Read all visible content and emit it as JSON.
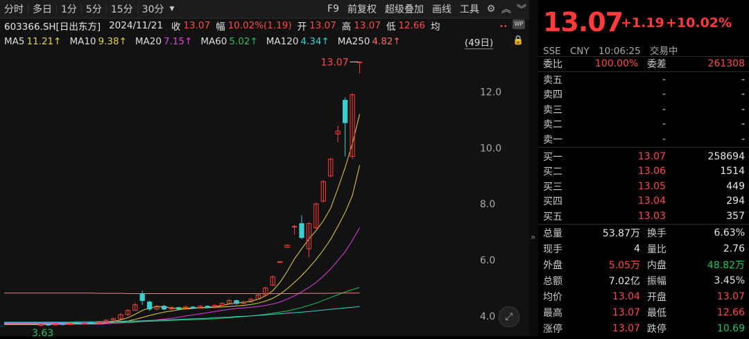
{
  "toolbar": {
    "periods": [
      "分时",
      "多日",
      "1分",
      "5分",
      "15分",
      "30分"
    ],
    "dropdown_icon": "triangle-down-icon",
    "right_items": [
      "F9",
      "前复权",
      "超级叠加",
      "画线",
      "工具"
    ],
    "right_icons": [
      "gear-icon",
      "chevron-up-double-icon",
      "chevron-down-double-icon"
    ]
  },
  "info": {
    "symbol": "603366.SH[日出东方]",
    "date": "2024/11/21",
    "close_label": "收",
    "close_value": "13.07",
    "change_label": "幅",
    "change_value": "10.02%(1.19)",
    "open_label": "开",
    "open_value": "13.07",
    "high_label": "高",
    "high_value": "13.07",
    "low_label": "低",
    "low_value": "12.66",
    "avg_label": "均"
  },
  "ma": [
    {
      "label": "MA5",
      "value": "11.21↑",
      "color": "#e6d44a"
    },
    {
      "label": "MA10",
      "value": "9.38↑",
      "color": "#e6d44a"
    },
    {
      "label": "MA20",
      "value": "7.15↑",
      "color": "#e040e0"
    },
    {
      "label": "MA60",
      "value": "5.02↑",
      "color": "#22c55e"
    },
    {
      "label": "MA120",
      "value": "4.34↑",
      "color": "#3ad0d0"
    },
    {
      "label": "MA250",
      "value": "4.82↑",
      "color": "#ff6a6a"
    }
  ],
  "period_badge": "(49日)",
  "wp_icon_text": "WP",
  "chart_annotations": {
    "max_label": "13.07",
    "min_label": "3.63",
    "y_ticks": [
      "12.0",
      "10.0",
      "8.0",
      "6.0",
      "4.0"
    ]
  },
  "chart_data": {
    "type": "candlestick",
    "y_ticks": [
      12.0,
      10.0,
      8.0,
      6.0,
      4.0
    ],
    "ylim": [
      3.6,
      13.3
    ],
    "grid": false,
    "candles": [
      {
        "o": 3.66,
        "c": 3.7,
        "h": 3.74,
        "l": 3.63
      },
      {
        "o": 3.7,
        "c": 3.68,
        "h": 3.73,
        "l": 3.65
      },
      {
        "o": 3.68,
        "c": 3.72,
        "h": 3.75,
        "l": 3.66
      },
      {
        "o": 3.72,
        "c": 3.7,
        "h": 3.76,
        "l": 3.68
      },
      {
        "o": 3.7,
        "c": 3.74,
        "h": 3.77,
        "l": 3.69
      },
      {
        "o": 3.74,
        "c": 3.72,
        "h": 3.78,
        "l": 3.7
      },
      {
        "o": 3.72,
        "c": 3.76,
        "h": 3.8,
        "l": 3.71
      },
      {
        "o": 3.76,
        "c": 3.74,
        "h": 3.79,
        "l": 3.72
      },
      {
        "o": 3.74,
        "c": 3.78,
        "h": 3.82,
        "l": 3.73
      },
      {
        "o": 3.78,
        "c": 3.85,
        "h": 3.88,
        "l": 3.76
      },
      {
        "o": 3.85,
        "c": 3.9,
        "h": 3.95,
        "l": 3.83
      },
      {
        "o": 3.9,
        "c": 4.05,
        "h": 4.1,
        "l": 3.88
      },
      {
        "o": 4.05,
        "c": 4.2,
        "h": 4.25,
        "l": 4.0
      },
      {
        "o": 4.2,
        "c": 4.4,
        "h": 4.48,
        "l": 4.18
      },
      {
        "o": 4.8,
        "c": 4.55,
        "h": 4.9,
        "l": 4.4
      },
      {
        "o": 4.5,
        "c": 4.25,
        "h": 4.55,
        "l": 4.18
      },
      {
        "o": 4.25,
        "c": 4.35,
        "h": 4.4,
        "l": 4.2
      },
      {
        "o": 4.35,
        "c": 4.25,
        "h": 4.4,
        "l": 4.2
      },
      {
        "o": 4.25,
        "c": 4.3,
        "h": 4.35,
        "l": 4.22
      },
      {
        "o": 4.3,
        "c": 4.25,
        "h": 4.33,
        "l": 4.2
      },
      {
        "o": 4.25,
        "c": 4.32,
        "h": 4.38,
        "l": 4.22
      },
      {
        "o": 4.32,
        "c": 4.28,
        "h": 4.36,
        "l": 4.25
      },
      {
        "o": 4.28,
        "c": 4.35,
        "h": 4.4,
        "l": 4.26
      },
      {
        "o": 4.35,
        "c": 4.3,
        "h": 4.38,
        "l": 4.27
      },
      {
        "o": 4.3,
        "c": 4.38,
        "h": 4.42,
        "l": 4.28
      },
      {
        "o": 4.38,
        "c": 4.45,
        "h": 4.5,
        "l": 4.35
      },
      {
        "o": 4.45,
        "c": 4.55,
        "h": 4.6,
        "l": 4.42
      },
      {
        "o": 4.55,
        "c": 4.45,
        "h": 4.58,
        "l": 4.4
      },
      {
        "o": 4.45,
        "c": 4.5,
        "h": 4.55,
        "l": 4.42
      },
      {
        "o": 4.5,
        "c": 4.6,
        "h": 4.65,
        "l": 4.48
      },
      {
        "o": 4.6,
        "c": 4.75,
        "h": 4.8,
        "l": 4.58
      },
      {
        "o": 4.75,
        "c": 5.0,
        "h": 5.05,
        "l": 4.72
      },
      {
        "o": 5.1,
        "c": 5.4,
        "h": 5.45,
        "l": 5.08
      },
      {
        "o": 5.94,
        "c": 5.94,
        "h": 5.94,
        "l": 5.94
      },
      {
        "o": 6.45,
        "c": 6.53,
        "h": 6.55,
        "l": 6.45
      },
      {
        "o": 7.18,
        "c": 7.2,
        "h": 7.25,
        "l": 6.9
      },
      {
        "o": 7.3,
        "c": 6.8,
        "h": 7.6,
        "l": 6.75
      },
      {
        "o": 6.4,
        "c": 7.3,
        "h": 7.35,
        "l": 6.1
      },
      {
        "o": 7.15,
        "c": 8.0,
        "h": 8.05,
        "l": 7.1
      },
      {
        "o": 8.1,
        "c": 8.8,
        "h": 8.85,
        "l": 8.05
      },
      {
        "o": 9.0,
        "c": 9.6,
        "h": 9.65,
        "l": 8.95
      },
      {
        "o": 10.5,
        "c": 10.6,
        "h": 10.8,
        "l": 10.2
      },
      {
        "o": 11.7,
        "c": 10.9,
        "h": 11.8,
        "l": 9.7
      },
      {
        "o": 9.7,
        "c": 11.9,
        "h": 11.95,
        "l": 9.6
      },
      {
        "o": 13.07,
        "c": 13.07,
        "h": 13.07,
        "l": 12.66
      }
    ],
    "ma_lines": [
      {
        "name": "MA5",
        "color": "#e6d44a",
        "values": [
          3.7,
          3.71,
          3.71,
          3.71,
          3.72,
          3.72,
          3.72,
          3.73,
          3.74,
          3.76,
          3.8,
          3.86,
          3.94,
          4.06,
          4.2,
          4.29,
          4.33,
          4.34,
          4.28,
          4.28,
          4.28,
          4.28,
          4.3,
          4.31,
          4.33,
          4.37,
          4.43,
          4.46,
          4.49,
          4.53,
          4.6,
          4.72,
          4.9,
          5.2,
          5.59,
          6.04,
          6.4,
          6.75,
          7.05,
          7.4,
          7.85,
          8.55,
          9.3,
          10.15,
          11.21
        ]
      },
      {
        "name": "MA10",
        "color": "#e6d44a",
        "values": [
          3.72,
          3.72,
          3.72,
          3.72,
          3.72,
          3.72,
          3.72,
          3.72,
          3.72,
          3.73,
          3.75,
          3.78,
          3.82,
          3.88,
          3.95,
          4.02,
          4.08,
          4.14,
          4.18,
          4.22,
          4.25,
          4.27,
          4.29,
          4.3,
          4.31,
          4.32,
          4.34,
          4.36,
          4.38,
          4.41,
          4.46,
          4.53,
          4.63,
          4.78,
          4.97,
          5.2,
          5.44,
          5.72,
          6.02,
          6.36,
          6.74,
          7.2,
          7.7,
          8.3,
          9.38
        ]
      },
      {
        "name": "MA20",
        "color": "#e040e0",
        "values": [
          3.74,
          3.74,
          3.74,
          3.74,
          3.74,
          3.74,
          3.74,
          3.74,
          3.74,
          3.74,
          3.74,
          3.75,
          3.76,
          3.78,
          3.8,
          3.83,
          3.86,
          3.89,
          3.92,
          3.96,
          4.0,
          4.04,
          4.08,
          4.12,
          4.16,
          4.2,
          4.24,
          4.27,
          4.29,
          4.31,
          4.34,
          4.38,
          4.43,
          4.5,
          4.6,
          4.72,
          4.86,
          5.02,
          5.2,
          5.42,
          5.68,
          5.98,
          6.3,
          6.7,
          7.15
        ]
      },
      {
        "name": "MA60",
        "color": "#22c55e",
        "values": [
          3.76,
          3.76,
          3.76,
          3.76,
          3.76,
          3.76,
          3.76,
          3.76,
          3.76,
          3.77,
          3.77,
          3.78,
          3.78,
          3.79,
          3.8,
          3.81,
          3.82,
          3.83,
          3.84,
          3.85,
          3.86,
          3.87,
          3.88,
          3.89,
          3.9,
          3.92,
          3.94,
          3.96,
          3.98,
          4.0,
          4.03,
          4.06,
          4.1,
          4.14,
          4.18,
          4.24,
          4.3,
          4.38,
          4.46,
          4.56,
          4.66,
          4.76,
          4.86,
          4.94,
          5.02
        ]
      },
      {
        "name": "MA120",
        "color": "#3ad0d0",
        "values": [
          3.78,
          3.78,
          3.78,
          3.78,
          3.78,
          3.79,
          3.79,
          3.79,
          3.8,
          3.8,
          3.81,
          3.81,
          3.82,
          3.82,
          3.83,
          3.84,
          3.85,
          3.86,
          3.87,
          3.88,
          3.89,
          3.9,
          3.91,
          3.92,
          3.94,
          3.95,
          3.96,
          3.98,
          3.99,
          4.0,
          4.02,
          4.04,
          4.06,
          4.08,
          4.1,
          4.12,
          4.14,
          4.16,
          4.19,
          4.21,
          4.24,
          4.26,
          4.29,
          4.31,
          4.34
        ]
      },
      {
        "name": "MA250",
        "color": "#ff7a7a",
        "values": [
          4.82,
          4.82,
          4.82,
          4.82,
          4.82,
          4.82,
          4.82,
          4.82,
          4.81,
          4.81,
          4.81,
          4.81,
          4.8,
          4.8,
          4.8,
          4.8,
          4.8,
          4.8,
          4.8,
          4.8,
          4.8,
          4.8,
          4.8,
          4.8,
          4.8,
          4.8,
          4.8,
          4.8,
          4.8,
          4.8,
          4.8,
          4.8,
          4.8,
          4.8,
          4.8,
          4.8,
          4.81,
          4.81,
          4.81,
          4.81,
          4.81,
          4.82,
          4.82,
          4.82,
          4.82
        ]
      }
    ]
  },
  "quote": {
    "price": "13.07",
    "change": "+1.19",
    "change_pct": "+10.02%",
    "exchange": "SSE",
    "currency": "CNY",
    "time": "10:06:25",
    "status": "交易中",
    "webi_label": "委比",
    "webi_value": "100.00%",
    "weicha_label": "委差",
    "weicha_value": "261308",
    "asks": [
      {
        "label": "卖五",
        "price": "-",
        "vol": "-"
      },
      {
        "label": "卖四",
        "price": "-",
        "vol": "-"
      },
      {
        "label": "卖三",
        "price": "-",
        "vol": "-"
      },
      {
        "label": "卖二",
        "price": "-",
        "vol": "-"
      },
      {
        "label": "卖一",
        "price": "-",
        "vol": "-"
      }
    ],
    "bids": [
      {
        "label": "买一",
        "price": "13.07",
        "vol": "258694"
      },
      {
        "label": "买二",
        "price": "13.06",
        "vol": "1514"
      },
      {
        "label": "买三",
        "price": "13.05",
        "vol": "449"
      },
      {
        "label": "买四",
        "price": "13.04",
        "vol": "294"
      },
      {
        "label": "买五",
        "price": "13.03",
        "vol": "357"
      }
    ],
    "stats": [
      [
        {
          "label": "总量",
          "value": "53.87万",
          "color": "#e6e6e6"
        },
        {
          "label": "换手",
          "value": "6.63%",
          "color": "#e6e6e6"
        }
      ],
      [
        {
          "label": "现手",
          "value": "4",
          "color": "#e6e6e6"
        },
        {
          "label": "量比",
          "value": "2.76",
          "color": "#e6e6e6"
        }
      ],
      [
        {
          "label": "外盘",
          "value": "5.05万",
          "color": "#ff4a4a"
        },
        {
          "label": "内盘",
          "value": "48.82万",
          "color": "#22c55e"
        }
      ],
      [
        {
          "label": "总额",
          "value": "7.02亿",
          "color": "#e6e6e6"
        },
        {
          "label": "振幅",
          "value": "3.45%",
          "color": "#e6e6e6"
        }
      ],
      [
        {
          "label": "均价",
          "value": "13.04",
          "color": "#ff4a4a"
        },
        {
          "label": "开盘",
          "value": "13.07",
          "color": "#ff4a4a"
        }
      ],
      [
        {
          "label": "最高",
          "value": "13.07",
          "color": "#ff4a4a"
        },
        {
          "label": "最低",
          "value": "12.66",
          "color": "#ff4a4a"
        }
      ],
      [
        {
          "label": "涨停",
          "value": "13.07",
          "color": "#ff4a4a"
        },
        {
          "label": "跌停",
          "value": "10.69",
          "color": "#22c55e"
        }
      ]
    ]
  },
  "colors": {
    "up": "#ff3b3b",
    "down": "#3ad0d0",
    "bg": "#121212"
  }
}
